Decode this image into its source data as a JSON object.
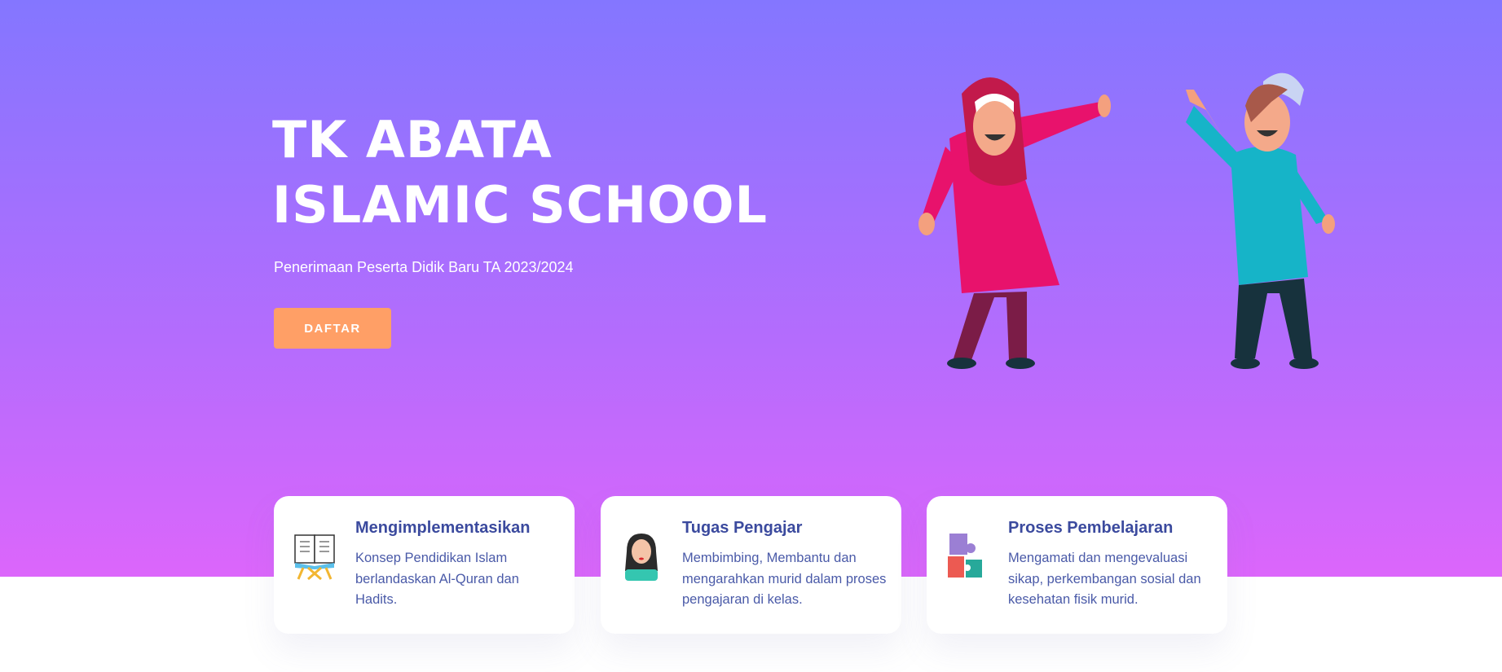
{
  "hero": {
    "title_line1": "TK ABATA",
    "title_line2": "ISLAMIC SCHOOL",
    "subtitle": "Penerimaan Peserta Didik Baru TA 2023/2024",
    "button_label": "DAFTAR"
  },
  "colors": {
    "gradient_top": "#8476ff",
    "gradient_bottom": "#dc66fb",
    "button": "#ff9f66",
    "card_title": "#3b4a9e"
  },
  "features": [
    {
      "icon": "quran-book-icon",
      "title": "Mengimplementasikan",
      "text": "Konsep Pendidikan Islam berlandaskan Al-Quran dan Hadits."
    },
    {
      "icon": "teacher-hijab-icon",
      "title": "Tugas Pengajar",
      "text": "Membimbing, Membantu dan mengarahkan murid dalam proses pengajaran di kelas."
    },
    {
      "icon": "puzzle-icon",
      "title": "Proses Pembelajaran",
      "text": "Mengamati dan mengevaluasi sikap, perkembangan sosial dan kesehatan fisik murid."
    }
  ]
}
